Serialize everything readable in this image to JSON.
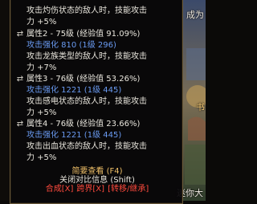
{
  "scene": {
    "top_right_text": "成为",
    "mid_right_text": "书",
    "bottom_right_text": "迷你大"
  },
  "tooltip": {
    "intro_lines": [
      "攻击灼伤状态的敌人时，技能攻击",
      "力 +5%"
    ],
    "attributes": [
      {
        "icon": "shuffle-icon",
        "title": "属性2 - 75级 (经验值 91.09%)",
        "enhance": "攻击强化 810 (1级 296)",
        "effect_lines": [
          "攻击龙族类型的敌人时，技能攻击",
          "力 +7%"
        ]
      },
      {
        "icon": "shuffle-icon",
        "title": "属性3 - 76级 (经验值 53.26%)",
        "enhance": "攻击强化 1221 (1级 445)",
        "effect_lines": [
          "攻击感电状态的敌人时，技能攻击",
          "力 +5%"
        ]
      },
      {
        "icon": "shuffle-icon",
        "title": "属性4 - 76级 (经验值 23.66%)",
        "enhance": "攻击强化 1221 (1级 445)",
        "effect_lines": [
          "攻击出血状态的敌人时，技能攻击",
          "力 +5%"
        ]
      }
    ],
    "brief_view": "简要查看 (F4)",
    "close_compare": "关闭对比信息 (Shift)",
    "actions": {
      "compose": "合成[X]",
      "cross_world": "跨界[X]",
      "inherit": "[转移/继承]"
    }
  },
  "colors": {
    "white_text": "#e9e6dd",
    "blue_text": "#6a9bf2",
    "gold_text": "#f0c068",
    "red_text": "#ff4a3d",
    "border": "#6b5a3a"
  }
}
